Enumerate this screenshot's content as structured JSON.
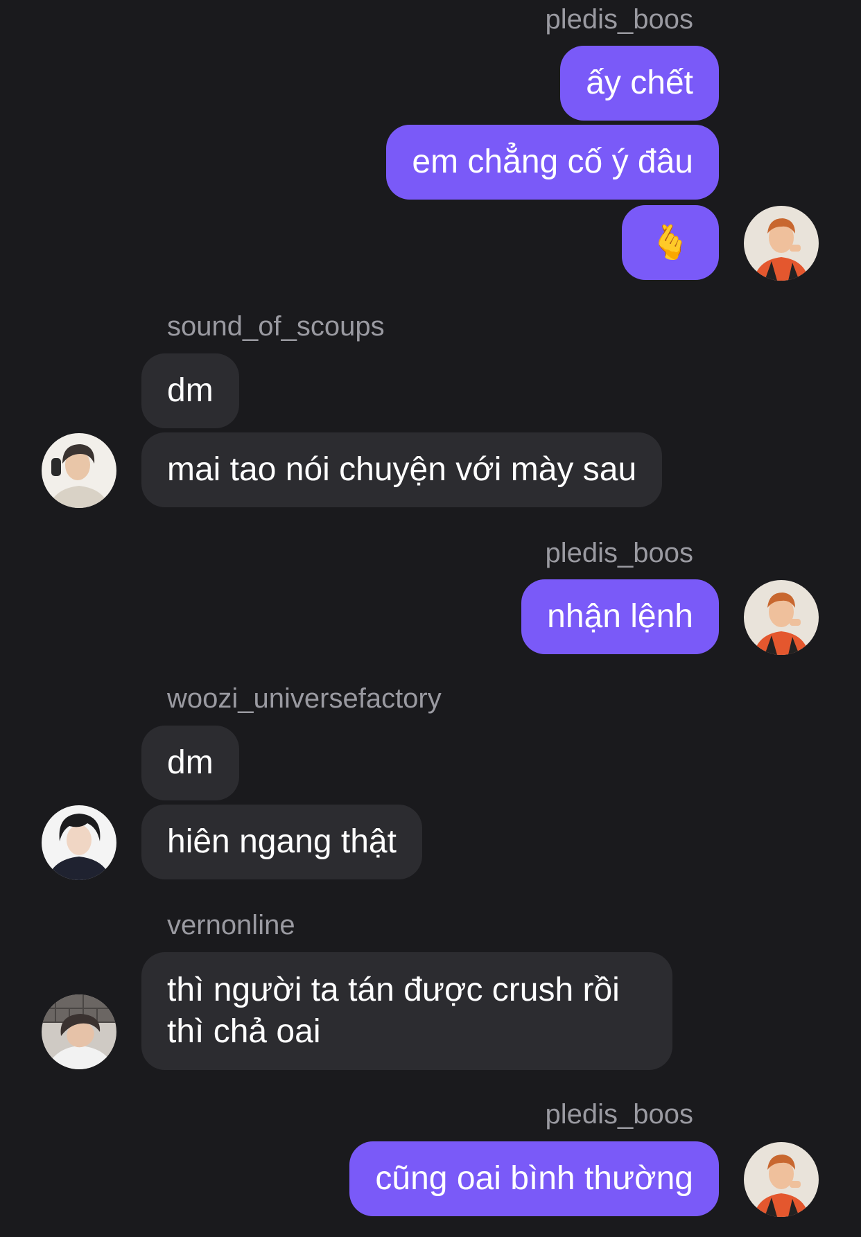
{
  "messages": [
    {
      "sender": "pledis_boos",
      "side": "out",
      "texts": [
        "ấy chết",
        "em chẳng cố ý đâu",
        "🫰"
      ]
    },
    {
      "sender": "sound_of_scoups",
      "side": "in",
      "texts": [
        "dm",
        "mai tao nói chuyện với mày sau"
      ]
    },
    {
      "sender": "pledis_boos",
      "side": "out",
      "texts": [
        "nhận lệnh"
      ]
    },
    {
      "sender": "woozi_universefactory",
      "side": "in",
      "texts": [
        "dm",
        "hiên ngang thật"
      ]
    },
    {
      "sender": "vernonline",
      "side": "in",
      "texts": [
        "thì người ta tán được crush rồi thì chả oai"
      ]
    },
    {
      "sender": "pledis_boos",
      "side": "out",
      "texts": [
        "cũng oai bình thường"
      ]
    }
  ],
  "colors": {
    "background": "#1a1a1d",
    "outgoing_bubble": "#7a5af8",
    "incoming_bubble": "#2c2c30",
    "sender_name": "#9a9aa1"
  },
  "icons": {
    "finger_heart": "finger-heart-emoji"
  }
}
